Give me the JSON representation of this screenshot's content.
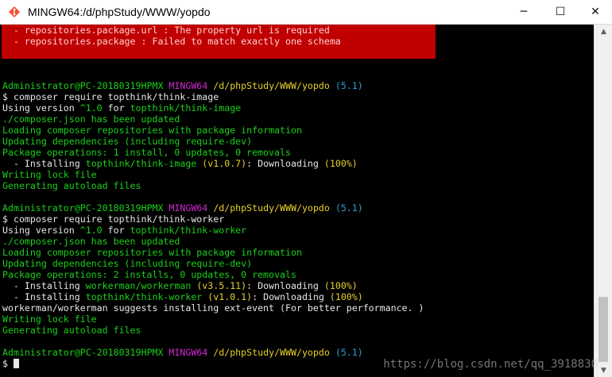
{
  "window": {
    "title": "MINGW64:/d/phpStudy/WWW/yopdo",
    "icon": "mingw-terminal-icon",
    "controls": {
      "minimize": "─",
      "maximize": "☐",
      "close": "✕"
    }
  },
  "colors": {
    "background": "#000000",
    "error_block": "#c00000",
    "text_green": "#1bd01b",
    "text_magenta": "#d12ad1",
    "text_yellow": "#e6d12a",
    "text_cyan": "#2aa0d0",
    "text_white": "#e6e6e6"
  },
  "terminal": {
    "errors": [
      "  - repositories.package.url : The property url is required",
      "  - repositories.package : Failed to match exactly one schema"
    ],
    "prompt": {
      "user": "Administrator@PC-20180319HPMX",
      "env": "MINGW64",
      "path": "/d/phpStudy/WWW/yopdo",
      "branch": "(5.1)",
      "symbol": "$"
    },
    "session1": {
      "command": " composer require topthink/think-image",
      "using_prefix": "Using version ",
      "using_version": "^1.0",
      "using_mid": " for ",
      "using_pkg": "topthink/think-image",
      "line_json": "./composer.json has been updated",
      "line_loading": "Loading composer repositories with package information",
      "line_updating": "Updating dependencies (including require-dev)",
      "line_ops": "Package operations: 1 install, 0 updates, 0 removals",
      "install": {
        "prefix": "  - Installing ",
        "pkg": "topthink/think-image",
        "ver": "(v1.0.7)",
        "mid": ": Downloading ",
        "pct": "(100%)"
      },
      "line_lock": "Writing lock file",
      "line_autoload": "Generating autoload files"
    },
    "session2": {
      "command": " composer require topthink/think-worker",
      "using_prefix": "Using version ",
      "using_version": "^1.0",
      "using_mid": " for ",
      "using_pkg": "topthink/think-worker",
      "line_json": "./composer.json has been updated",
      "line_loading": "Loading composer repositories with package information",
      "line_updating": "Updating dependencies (including require-dev)",
      "line_ops": "Package operations: 2 installs, 0 updates, 0 removals",
      "install1": {
        "prefix": "  - Installing ",
        "pkg": "workerman/workerman",
        "ver": "(v3.5.11)",
        "mid": ": Downloading ",
        "pct": "(100%)"
      },
      "install2": {
        "prefix": "  - Installing ",
        "pkg": "topthink/think-worker",
        "ver": "(v1.0.1)",
        "mid": ": Downloading ",
        "pct": "(100%)"
      },
      "line_suggest": "workerman/workerman suggests installing ext-event (For better performance. )",
      "line_lock": "Writing lock file",
      "line_autoload": "Generating autoload files"
    }
  },
  "watermark": "https://blog.csdn.net/qq_3918830"
}
